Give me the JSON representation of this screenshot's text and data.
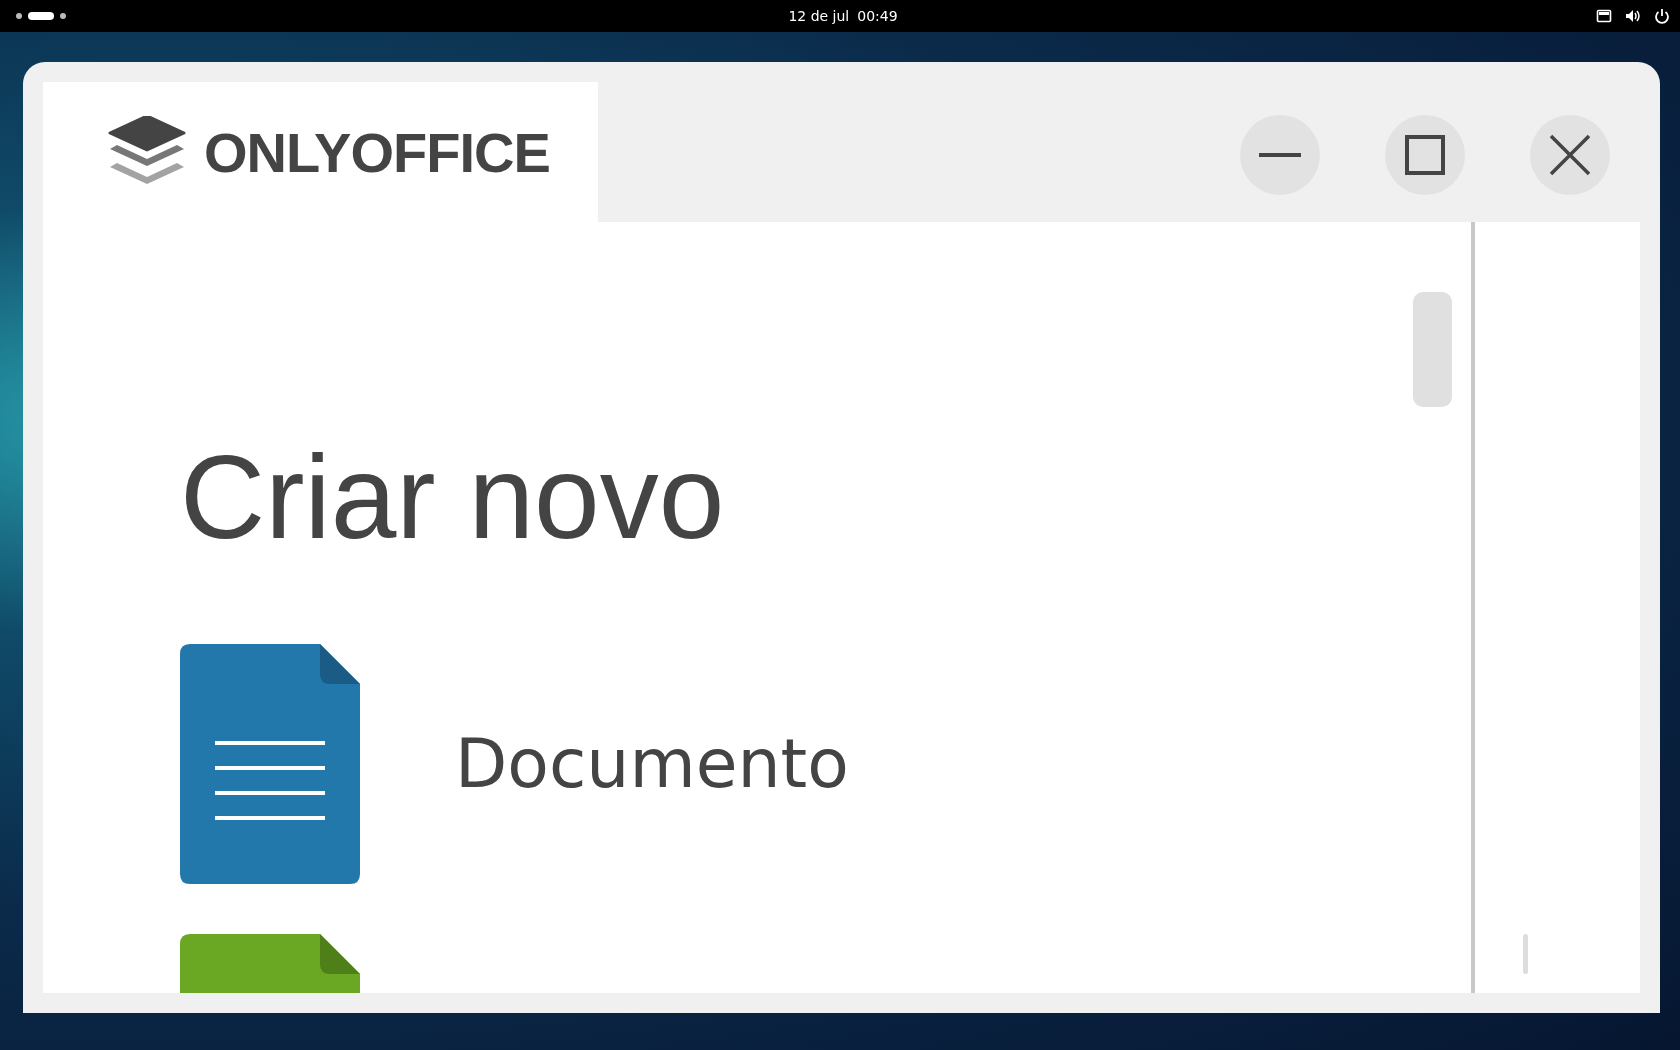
{
  "top_bar": {
    "date": "12 de jul",
    "time": "00:49"
  },
  "window": {
    "app_name": "ONLYOFFICE"
  },
  "create_new": {
    "title": "Criar novo",
    "items": [
      {
        "kind": "document",
        "label": "Documento"
      },
      {
        "kind": "spreadsheet"
      }
    ]
  }
}
